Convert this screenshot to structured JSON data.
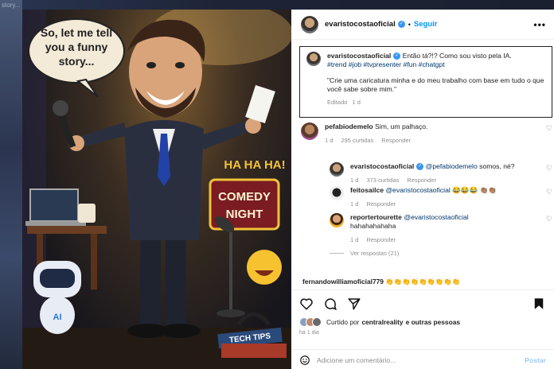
{
  "left_strip": {
    "chip_top": "story..."
  },
  "image": {
    "speech_bubble": "So, let me tell you a funny story...",
    "ha_text": "HA HA HA!",
    "sign_line1": "COMEDY",
    "sign_line2": "NIGHT",
    "robot_label": "AI",
    "book_label": "TECH TIPS"
  },
  "header": {
    "username": "evaristocostaoficial",
    "dot": "•",
    "follow": "Seguir",
    "more": "•••"
  },
  "caption": {
    "username": "evaristocostaoficial",
    "text": "Então tá?!? Como sou visto pela IA.",
    "hashtags": "#trend #job #tvpresenter #fun #chatgpt",
    "quote": "\"Crie uma caricatura minha e do meu trabalho com base em tudo o que você sabe sobre mim.\"",
    "edited": "Editado",
    "time": "1 d"
  },
  "comments": [
    {
      "username": "pefabiodemelo",
      "text": "Sim, um palhaço.",
      "time": "1 d",
      "likes": "295 curtidas",
      "reply": "Responder"
    },
    {
      "username": "evaristocostaoficial",
      "mention": "@pefabiodemelo",
      "text": "somos, né?",
      "time": "1 d",
      "likes": "373 curtidas",
      "reply": "Responder"
    },
    {
      "username": "feitosailce",
      "mention": "@evaristocostaoficial",
      "text": "😂😂😂 👏🏽👏🏽",
      "time": "1 d",
      "reply": "Responder"
    },
    {
      "username": "reportertourette",
      "mention": "@evaristocostaoficial",
      "text": "hahahahahaha",
      "time": "1 d",
      "reply": "Responder"
    }
  ],
  "view_replies": "Ver respostas (21)",
  "partial_comment": "fernandowilliamoficial779 👏👏👏👏👏👏👏👏👏",
  "actions": {
    "liked_by_prefix": "Curtido por",
    "liked_by_user": "centralreality",
    "liked_by_suffix": "e outras pessoas",
    "ago": "há 1 dia",
    "add_comment_placeholder": "Adicione um comentário...",
    "post_button": "Postar"
  }
}
